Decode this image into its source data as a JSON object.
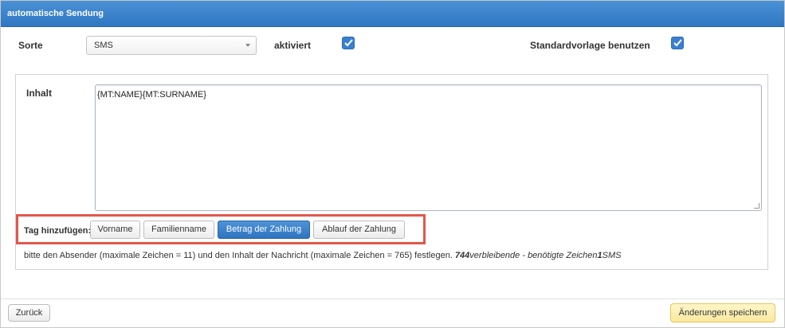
{
  "window": {
    "title": "automatische Sendung"
  },
  "form": {
    "sorte_label": "Sorte",
    "sorte_value": "SMS",
    "aktiviert_label": "aktiviert",
    "aktiviert_checked": true,
    "standard_label": "Standardvorlage benutzen",
    "standard_checked": true
  },
  "content": {
    "label": "Inhalt",
    "text": "{MT:NAME}{MT:SURNAME}"
  },
  "tags": {
    "label": "Tag hinzufügen:",
    "buttons": [
      "Vorname",
      "Familienname",
      "Betrag der Zahlung",
      "Ablauf der Zahlung"
    ],
    "active": "Betrag der Zahlung"
  },
  "hint": {
    "text": "bitte den Absender (maximale Zeichen = 11) und den Inhalt der Nachricht (maximale Zeichen = 765) festlegen.",
    "remaining_count": "744",
    "remaining_label": "verbleibende - benötigte Zeichen",
    "sms_count": "1",
    "sms_label": "SMS"
  },
  "footer": {
    "back_label": "Zurück",
    "save_label": "Änderungen speichern"
  },
  "colors": {
    "accent": "#3a7fcf",
    "highlight_border": "#e2574c",
    "save_button": "#fbe8a0"
  }
}
